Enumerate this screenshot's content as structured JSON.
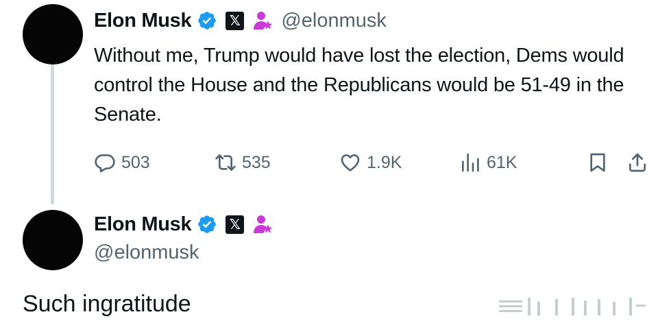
{
  "post": {
    "author_name": "Elon Musk",
    "author_handle": "@elonmusk",
    "text": "Without me, Trump would have lost the election, Dems would control the House and the Republicans would be 51-49 in the Senate.",
    "stats": {
      "replies": "503",
      "reposts": "535",
      "likes": "1.9K",
      "views": "61K"
    }
  },
  "reply": {
    "author_name": "Elon Musk",
    "author_handle": "@elonmusk",
    "text": "Such ingratitude"
  },
  "icons": {
    "verified": "verified-badge-icon",
    "x_logo": "x-logo-icon",
    "affiliate": "affiliate-person-icon",
    "reply": "speech-bubble-icon",
    "repost": "repost-arrows-icon",
    "like": "heart-icon",
    "views": "bar-chart-icon",
    "bookmark": "bookmark-icon",
    "share": "share-upload-icon"
  },
  "colors": {
    "verified_blue": "#1d9bf0",
    "secondary_text": "#536471",
    "primary_text": "#0f1419",
    "affiliate_pink": "#c93bd6"
  }
}
